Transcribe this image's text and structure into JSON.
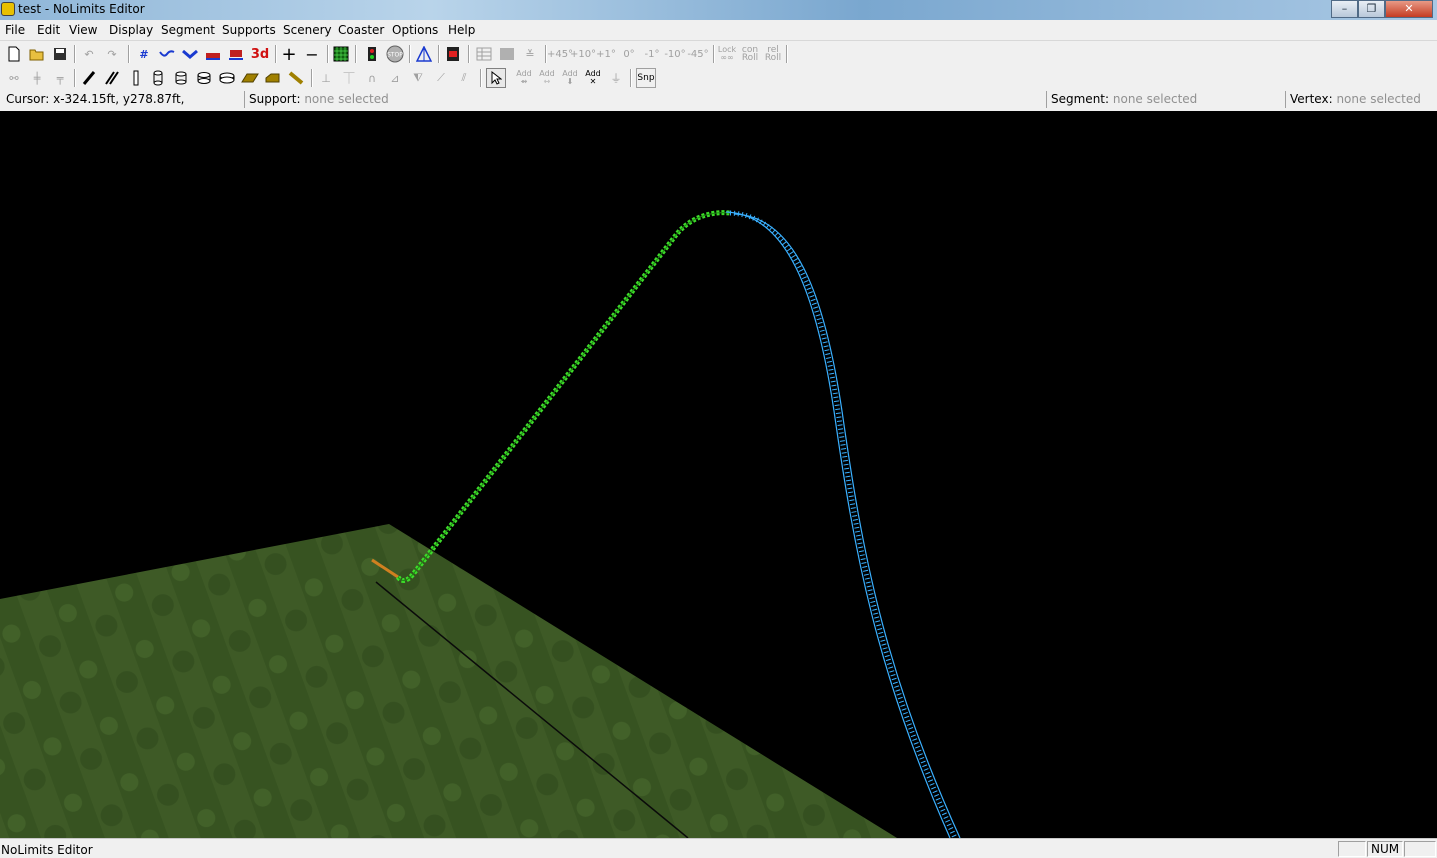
{
  "window": {
    "title": "test - NoLimits Editor",
    "minimize": "–",
    "restore": "❐",
    "close": "✕"
  },
  "menu": [
    "File",
    "Edit",
    "View",
    "Display",
    "Segment",
    "Supports",
    "Scenery",
    "Coaster",
    "Options",
    "Help"
  ],
  "toolbar1": {
    "btn_3d": "3d",
    "btn_stop": "STOP",
    "roll_plus45": "+45°",
    "roll_plus10": "+10°",
    "roll_plus1": "+1°",
    "roll_0": "0°",
    "roll_minus1": "-1°",
    "roll_minus10": "-10°",
    "roll_minus45": "-45°",
    "lock_top": "Lock",
    "lock_bottom": "∞∞",
    "con_top": "con",
    "con_bottom": "Roll",
    "rel_top": "rel",
    "rel_bottom": "Roll"
  },
  "toolbar2": {
    "add1": "Add",
    "add2": "Add",
    "add3": "Add",
    "add4": "Add",
    "snap": "Snp"
  },
  "info": {
    "cursor_label": "Cursor:",
    "cursor_value": "x-324.15ft, y278.87ft,",
    "support_label": "Support:",
    "support_value": "none selected",
    "segment_label": "Segment:",
    "segment_value": "none selected",
    "vertex_label": "Vertex:",
    "vertex_value": "none selected"
  },
  "statusbar": {
    "text": "NoLimits Editor",
    "num": "NUM"
  },
  "colors": {
    "track_green": "#3ddc2a",
    "track_blue": "#3ab0ff",
    "ground": "#3e5a26",
    "viewport_bg": "#000000"
  }
}
